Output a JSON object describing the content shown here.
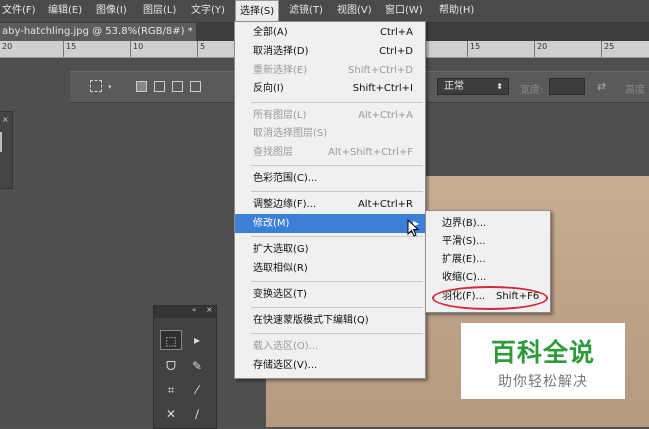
{
  "menubar": {
    "items": [
      "文件(F)",
      "编辑(E)",
      "图像(I)",
      "图层(L)",
      "文字(Y)",
      "选择(S)",
      "滤镜(T)",
      "视图(V)",
      "窗口(W)",
      "帮助(H)"
    ]
  },
  "document": {
    "tab_title": "aby-hatchling.jpg @ 53.8%(RGB/8#) *",
    "close_glyph": "×"
  },
  "ruler": {
    "ticks": [
      "20",
      "15",
      "10",
      "5",
      "15",
      "20",
      "25"
    ]
  },
  "options_bar": {
    "mode_value": "正常",
    "width_label": "宽度:",
    "height_label": "高度"
  },
  "select_menu": {
    "items": [
      {
        "label": "全部(A)",
        "shortcut": "Ctrl+A",
        "disabled": false
      },
      {
        "label": "取消选择(D)",
        "shortcut": "Ctrl+D",
        "disabled": false
      },
      {
        "label": "重新选择(E)",
        "shortcut": "Shift+Ctrl+D",
        "disabled": true
      },
      {
        "label": "反向(I)",
        "shortcut": "Shift+Ctrl+I",
        "disabled": false
      },
      {
        "label": "所有图层(L)",
        "shortcut": "Alt+Ctrl+A",
        "disabled": true
      },
      {
        "label": "取消选择图层(S)",
        "shortcut": "",
        "disabled": true
      },
      {
        "label": "查找图层",
        "shortcut": "Alt+Shift+Ctrl+F",
        "disabled": true
      },
      {
        "label": "色彩范围(C)...",
        "shortcut": "",
        "disabled": false
      },
      {
        "label": "调整边缘(F)...",
        "shortcut": "Alt+Ctrl+R",
        "disabled": false
      },
      {
        "label": "修改(M)",
        "shortcut": "",
        "disabled": false,
        "highlighted": true
      },
      {
        "label": "扩大选取(G)",
        "shortcut": "",
        "disabled": false
      },
      {
        "label": "选取相似(R)",
        "shortcut": "",
        "disabled": false
      },
      {
        "label": "变换选区(T)",
        "shortcut": "",
        "disabled": false
      },
      {
        "label": "在快速蒙版模式下编辑(Q)",
        "shortcut": "",
        "disabled": false
      },
      {
        "label": "载入选区(O)...",
        "shortcut": "",
        "disabled": true
      },
      {
        "label": "存储选区(V)...",
        "shortcut": "",
        "disabled": false
      }
    ]
  },
  "modify_submenu": {
    "items": [
      {
        "label": "边界(B)...",
        "shortcut": ""
      },
      {
        "label": "平滑(S)...",
        "shortcut": ""
      },
      {
        "label": "扩展(E)...",
        "shortcut": ""
      },
      {
        "label": "收缩(C)...",
        "shortcut": ""
      },
      {
        "label": "羽化(F)...",
        "shortcut": "Shift+F6"
      }
    ]
  },
  "watermark": {
    "title": "百科全说",
    "subtitle": "助你轻松解决"
  },
  "colors": {
    "menu_highlight": "#3b80d6",
    "annotation_red": "#d3283b",
    "watermark_green": "#2e9a39"
  },
  "icons": [
    "marquee-icon",
    "move-icon",
    "lasso-icon",
    "quick-select-icon",
    "crop-icon",
    "eyedropper-icon",
    "healing-icon",
    "brush-icon",
    "chevron-right-icon",
    "mouse-cursor-icon"
  ]
}
